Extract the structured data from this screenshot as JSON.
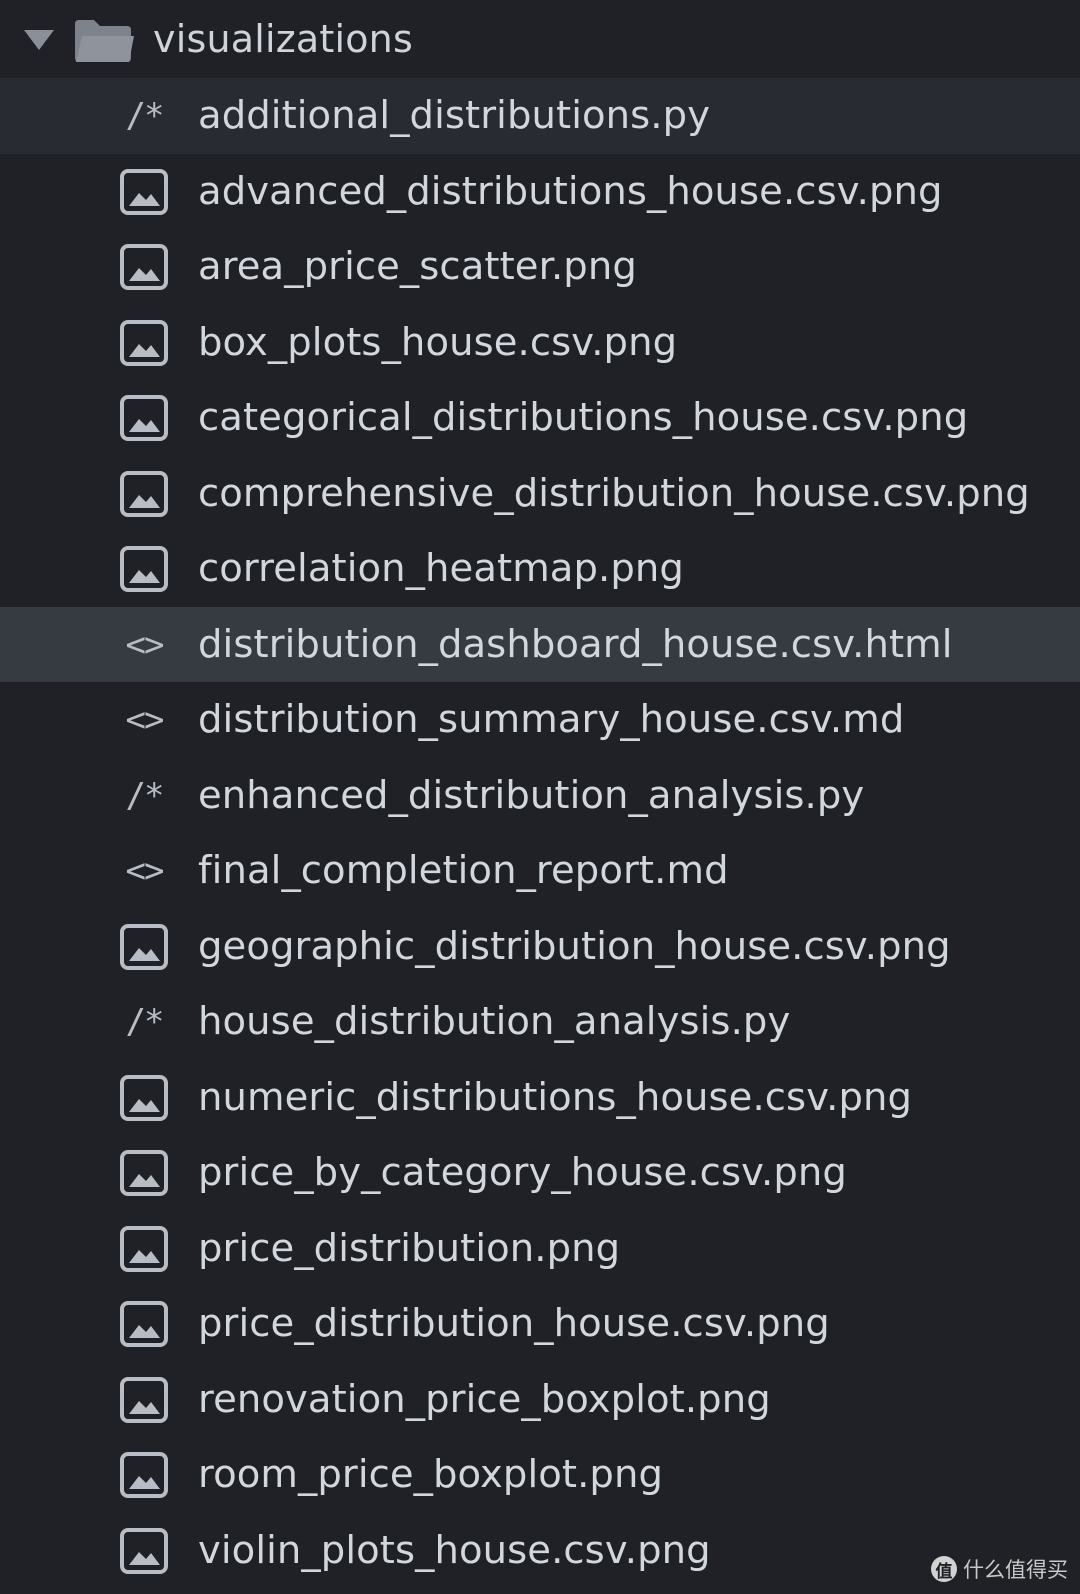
{
  "folder": {
    "name": "visualizations",
    "expanded": true,
    "chevron_icon": "chevron-down-icon",
    "icon": "folder-icon"
  },
  "files": [
    {
      "name": "additional_distributions.py",
      "icon": "python-comment-icon",
      "glyph": "/*",
      "state": "hover"
    },
    {
      "name": "advanced_distributions_house.csv.png",
      "icon": "image-icon"
    },
    {
      "name": "area_price_scatter.png",
      "icon": "image-icon"
    },
    {
      "name": "box_plots_house.csv.png",
      "icon": "image-icon"
    },
    {
      "name": "categorical_distributions_house.csv.png",
      "icon": "image-icon"
    },
    {
      "name": "comprehensive_distribution_house.csv.png",
      "icon": "image-icon"
    },
    {
      "name": "correlation_heatmap.png",
      "icon": "image-icon"
    },
    {
      "name": "distribution_dashboard_house.csv.html",
      "icon": "code-icon",
      "glyph": "<>",
      "state": "selected"
    },
    {
      "name": "distribution_summary_house.csv.md",
      "icon": "code-icon",
      "glyph": "<>"
    },
    {
      "name": "enhanced_distribution_analysis.py",
      "icon": "python-comment-icon",
      "glyph": "/*"
    },
    {
      "name": "final_completion_report.md",
      "icon": "code-icon",
      "glyph": "<>"
    },
    {
      "name": "geographic_distribution_house.csv.png",
      "icon": "image-icon"
    },
    {
      "name": "house_distribution_analysis.py",
      "icon": "python-comment-icon",
      "glyph": "/*"
    },
    {
      "name": "numeric_distributions_house.csv.png",
      "icon": "image-icon"
    },
    {
      "name": "price_by_category_house.csv.png",
      "icon": "image-icon"
    },
    {
      "name": "price_distribution.png",
      "icon": "image-icon"
    },
    {
      "name": "price_distribution_house.csv.png",
      "icon": "image-icon"
    },
    {
      "name": "renovation_price_boxplot.png",
      "icon": "image-icon"
    },
    {
      "name": "room_price_boxplot.png",
      "icon": "image-icon"
    },
    {
      "name": "violin_plots_house.csv.png",
      "icon": "image-icon"
    }
  ],
  "watermark": {
    "text": "什么值得买",
    "logo_glyph": "值"
  },
  "colors": {
    "background": "#1f2126",
    "hover_row": "#282b31",
    "selected_row": "#363a41",
    "text": "#d2d6dd",
    "icon": "#b8bcc4"
  }
}
